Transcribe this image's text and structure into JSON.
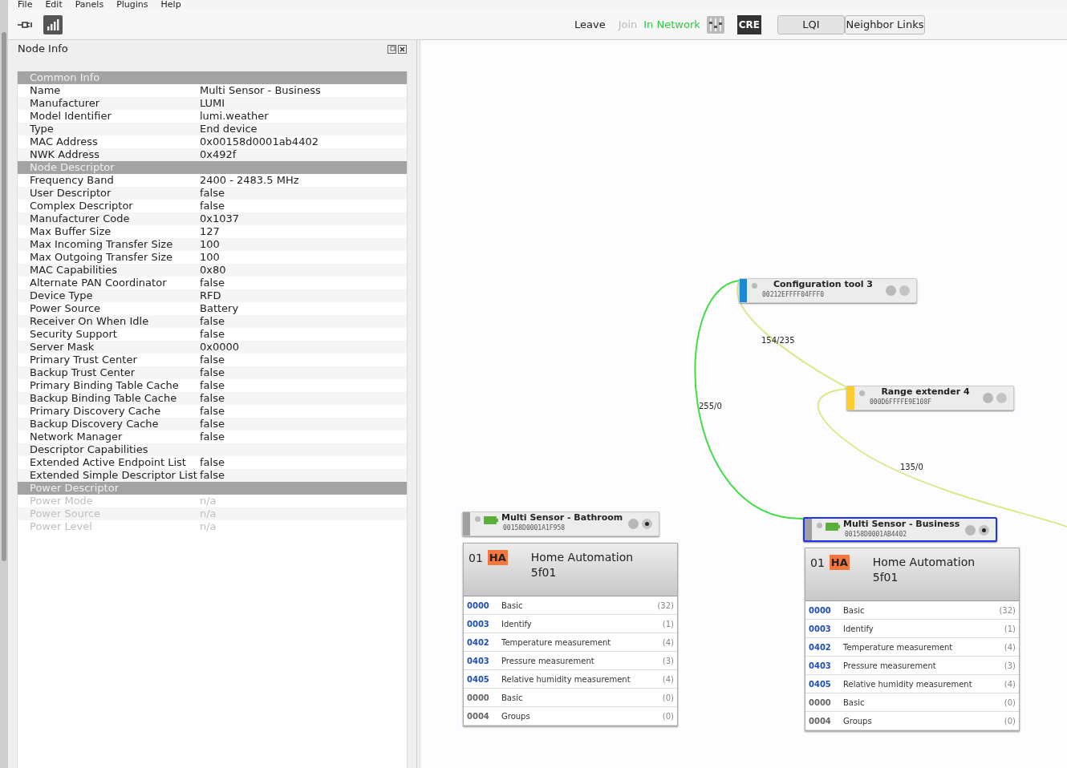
{
  "menu": [
    "File",
    "Edit",
    "Panels",
    "Plugins",
    "Help"
  ],
  "toolbar": {
    "leave": "Leave",
    "join": "Join",
    "join_disabled": true,
    "status": "In Network",
    "cre": "CRE",
    "buttons": [
      {
        "label": "LQI",
        "selected": true
      },
      {
        "label": "Neighbor Links",
        "selected": false
      }
    ]
  },
  "panel": {
    "title": "Node Info",
    "sections": [
      {
        "title": "Common Info",
        "rows": [
          {
            "label": "Name",
            "value": "Multi Sensor - Business",
            "disabled": false
          },
          {
            "label": "Manufacturer",
            "value": "LUMI",
            "disabled": false
          },
          {
            "label": "Model Identifier",
            "value": "lumi.weather",
            "disabled": false
          },
          {
            "label": "Type",
            "value": "End device",
            "disabled": false
          },
          {
            "label": "MAC Address",
            "value": "0x00158d0001ab4402",
            "disabled": false
          },
          {
            "label": "NWK Address",
            "value": "0x492f",
            "disabled": false
          }
        ]
      },
      {
        "title": "Node Descriptor",
        "rows": [
          {
            "label": "Frequency Band",
            "value": "2400 - 2483.5 MHz",
            "disabled": false
          },
          {
            "label": "User Descriptor",
            "value": "false",
            "disabled": false
          },
          {
            "label": "Complex Descriptor",
            "value": "false",
            "disabled": false
          },
          {
            "label": "Manufacturer Code",
            "value": "0x1037",
            "disabled": false
          },
          {
            "label": "Max Buffer Size",
            "value": "127",
            "disabled": false
          },
          {
            "label": "Max Incoming Transfer Size",
            "value": "100",
            "disabled": false
          },
          {
            "label": "Max Outgoing Transfer Size",
            "value": "100",
            "disabled": false
          },
          {
            "label": "MAC Capabilities",
            "value": "0x80",
            "disabled": false
          },
          {
            "label": "Alternate PAN Coordinator",
            "value": "false",
            "disabled": false
          },
          {
            "label": "Device Type",
            "value": "RFD",
            "disabled": false
          },
          {
            "label": "Power Source",
            "value": "Battery",
            "disabled": false
          },
          {
            "label": "Receiver On When Idle",
            "value": "false",
            "disabled": false
          },
          {
            "label": "Security Support",
            "value": "false",
            "disabled": false
          },
          {
            "label": "Server Mask",
            "value": "0x0000",
            "disabled": false
          },
          {
            "label": "Primary Trust Center",
            "value": "false",
            "disabled": false
          },
          {
            "label": "Backup Trust Center",
            "value": "false",
            "disabled": false
          },
          {
            "label": "Primary Binding Table Cache",
            "value": "false",
            "disabled": false
          },
          {
            "label": "Backup Binding Table Cache",
            "value": "false",
            "disabled": false
          },
          {
            "label": "Primary Discovery Cache",
            "value": "false",
            "disabled": false
          },
          {
            "label": "Backup Discovery Cache",
            "value": "false",
            "disabled": false
          },
          {
            "label": "Network Manager",
            "value": "false",
            "disabled": false
          },
          {
            "label": "Descriptor Capabilities",
            "disabled": false
          },
          {
            "label": "Extended Active Endpoint List",
            "value": "false",
            "disabled": false
          },
          {
            "label": "Extended Simple Descriptor List",
            "value": "false",
            "disabled": false
          }
        ]
      },
      {
        "title": "Power Descriptor",
        "rows": [
          {
            "label": "Power Mode",
            "value": "n/a",
            "disabled": true
          },
          {
            "label": "Power Source",
            "value": "n/a",
            "disabled": true
          },
          {
            "label": "Power Level",
            "value": "n/a",
            "disabled": true
          }
        ]
      }
    ]
  },
  "nodes": [
    {
      "name": "Configuration tool 3",
      "address": "00212EFFFF04FFF0",
      "color": "#1e88d8",
      "selected": false,
      "battery": false
    },
    {
      "name": "Range extender 4",
      "address": "000D6FFFFE9E108F",
      "color": "#fdcd2f",
      "selected": false,
      "battery": false
    },
    {
      "name": "Multi Sensor - Bathroom",
      "address": "00158D0001A1F958",
      "color": "#a0a0a0",
      "selected": false,
      "battery": true,
      "endpoint": {
        "number": "01",
        "profile_badge": "HA",
        "profile": "Home Automation",
        "device_id": "5f01",
        "clusters": [
          {
            "id": "0000",
            "name": "Basic",
            "count": "(32)",
            "kind": "server"
          },
          {
            "id": "0003",
            "name": "Identify",
            "count": "(1)",
            "kind": "server"
          },
          {
            "id": "0402",
            "name": "Temperature measurement",
            "count": "(4)",
            "kind": "server"
          },
          {
            "id": "0403",
            "name": "Pressure measurement",
            "count": "(3)",
            "kind": "server"
          },
          {
            "id": "0405",
            "name": "Relative humidity measurement",
            "count": "(4)",
            "kind": "server"
          },
          {
            "id": "0000",
            "name": "Basic",
            "count": "(0)",
            "kind": "client"
          },
          {
            "id": "0004",
            "name": "Groups",
            "count": "(0)",
            "kind": "client"
          }
        ]
      }
    },
    {
      "name": "Multi Sensor - Business",
      "address": "00158D0001AB4402",
      "color": "#a0a0a0",
      "selected": true,
      "battery": true,
      "endpoint": {
        "number": "01",
        "profile_badge": "HA",
        "profile": "Home Automation",
        "device_id": "5f01",
        "clusters": [
          {
            "id": "0000",
            "name": "Basic",
            "count": "(32)",
            "kind": "server"
          },
          {
            "id": "0003",
            "name": "Identify",
            "count": "(1)",
            "kind": "server"
          },
          {
            "id": "0402",
            "name": "Temperature measurement",
            "count": "(4)",
            "kind": "server"
          },
          {
            "id": "0403",
            "name": "Pressure measurement",
            "count": "(3)",
            "kind": "server"
          },
          {
            "id": "0405",
            "name": "Relative humidity measurement",
            "count": "(4)",
            "kind": "server"
          },
          {
            "id": "0000",
            "name": "Basic",
            "count": "(0)",
            "kind": "client"
          },
          {
            "id": "0004",
            "name": "Groups",
            "count": "(0)",
            "kind": "client"
          }
        ]
      }
    }
  ],
  "links": [
    {
      "label": "255/0",
      "color": "#44dd44"
    },
    {
      "label": "154/235",
      "color": "#dde888"
    },
    {
      "label": "135/0",
      "color": "#dde888"
    }
  ]
}
